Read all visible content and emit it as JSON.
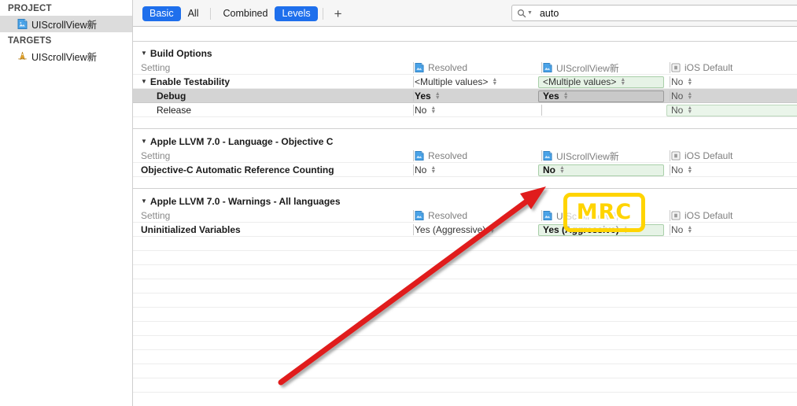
{
  "sidebar": {
    "project_header": "PROJECT",
    "targets_header": "TARGETS",
    "project_item": "UIScrollView新",
    "target_item": "UIScrollView新"
  },
  "toolbar": {
    "segments": [
      {
        "label": "Basic",
        "selected": true
      },
      {
        "label": "All",
        "selected": false
      },
      {
        "label": "Combined",
        "selected": false
      },
      {
        "label": "Levels",
        "selected": true
      }
    ],
    "add_label": "+",
    "search": {
      "value": "auto",
      "placeholder": "Search"
    }
  },
  "columns": {
    "setting": "Setting",
    "resolved": "Resolved",
    "target": "UIScrollView新",
    "default": "iOS Default"
  },
  "sections": [
    {
      "title": "Build Options",
      "groups": [
        {
          "name": "Enable Testability",
          "resolved": "<Multiple values>",
          "target": "<Multiple values>",
          "default": "No",
          "rows": [
            {
              "name": "Debug",
              "resolved": "Yes",
              "target": "Yes",
              "default": "No",
              "selected": true
            },
            {
              "name": "Release",
              "resolved": "No",
              "target": "",
              "default": "No",
              "selected": false
            }
          ]
        }
      ]
    },
    {
      "title": "Apple LLVM 7.0 - Language - Objective C",
      "settings": [
        {
          "name": "Objective-C Automatic Reference Counting",
          "resolved": "No",
          "target": "No",
          "default": "No"
        }
      ]
    },
    {
      "title": "Apple LLVM 7.0 - Warnings - All languages",
      "settings": [
        {
          "name": "Uninitialized Variables",
          "resolved": "Yes (Aggressive)",
          "target": "Yes (Aggressive)",
          "default": "No"
        }
      ]
    }
  ],
  "annotations": {
    "callout_label": "MRC",
    "callout_color": "#ffd400",
    "arrow_color": "#e01b1b"
  }
}
